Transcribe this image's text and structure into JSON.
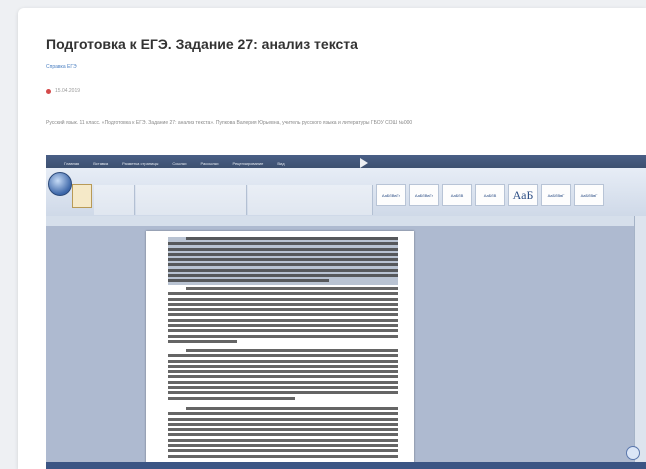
{
  "article": {
    "title": "Подготовка к ЕГЭ. Задание 27: анализ текста",
    "category": "Справка ЕГЭ",
    "date": "15.04.2019",
    "description": "Русский язык. 11 класс. «Подготовка к ЕГЭ. Задание 27: анализ текста». Пупкова Валерия Юрьевна, учитель русского языка и литературы ГБОУ СОШ №000"
  },
  "video": {
    "app": "Microsoft Word",
    "ribbon_tabs": [
      "Главная",
      "Вставка",
      "Разметка страницы",
      "Ссылки",
      "Рассылки",
      "Рецензирование",
      "Вид"
    ],
    "style_samples": [
      "АаБбВвГг",
      "АаБбВвГг",
      "АаБбВ",
      "АаБбВ",
      "АаБ",
      "АаБбВвГ",
      "АаБбВвГ"
    ]
  },
  "colors": {
    "page_bg": "#eef0f3",
    "card_bg": "#ffffff",
    "title": "#333333",
    "link": "#4a7fc1",
    "date_icon": "#d44a4a",
    "word_chrome": "#3d5070",
    "ribbon": "#dfe7f2",
    "selection": "#b9c3d2"
  }
}
